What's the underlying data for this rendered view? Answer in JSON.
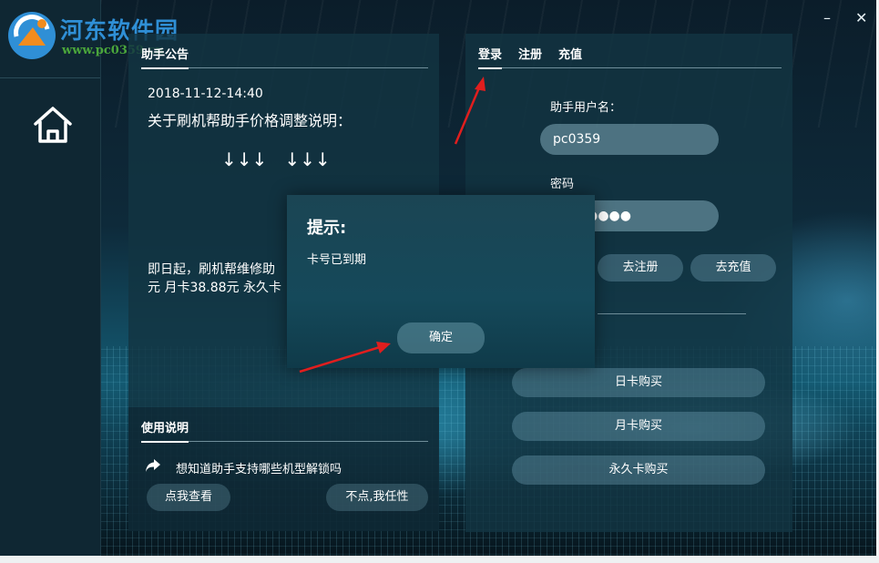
{
  "watermark": {
    "title": "河东软件园",
    "url": "www.pc0359.cn"
  },
  "window": {
    "minimize": "–",
    "close": "✕"
  },
  "announcement": {
    "tab": "助手公告",
    "date": "2018-11-12-14:40",
    "headline": "关于刷机帮助手价格调整说明：",
    "arrows": "↓↓↓   ↓↓↓",
    "body_line1": "即日起，刷机帮维修助",
    "body_line2": "元 月卡38.88元 永久卡"
  },
  "instructions": {
    "tab": "使用说明",
    "question": "想知道助手支持哪些机型解锁吗",
    "view_button": "点我查看",
    "skip_button": "不点,我任性"
  },
  "auth": {
    "tabs": [
      "登录",
      "注册",
      "充值"
    ],
    "username_label": "助手用户名：",
    "username_value": "pc0359",
    "password_label": "密码",
    "password_value": "●●●●",
    "register_button": "去注册",
    "recharge_button": "去充值",
    "buy_day": "日卡购买",
    "buy_month": "月卡购买",
    "buy_forever": "永久卡购买"
  },
  "dialog": {
    "title": "提示:",
    "message": "卡号已到期",
    "ok_button": "确定"
  },
  "colors": {
    "accent": "#ffffff",
    "arrow": "#e01e1e",
    "panel": "#123442"
  }
}
